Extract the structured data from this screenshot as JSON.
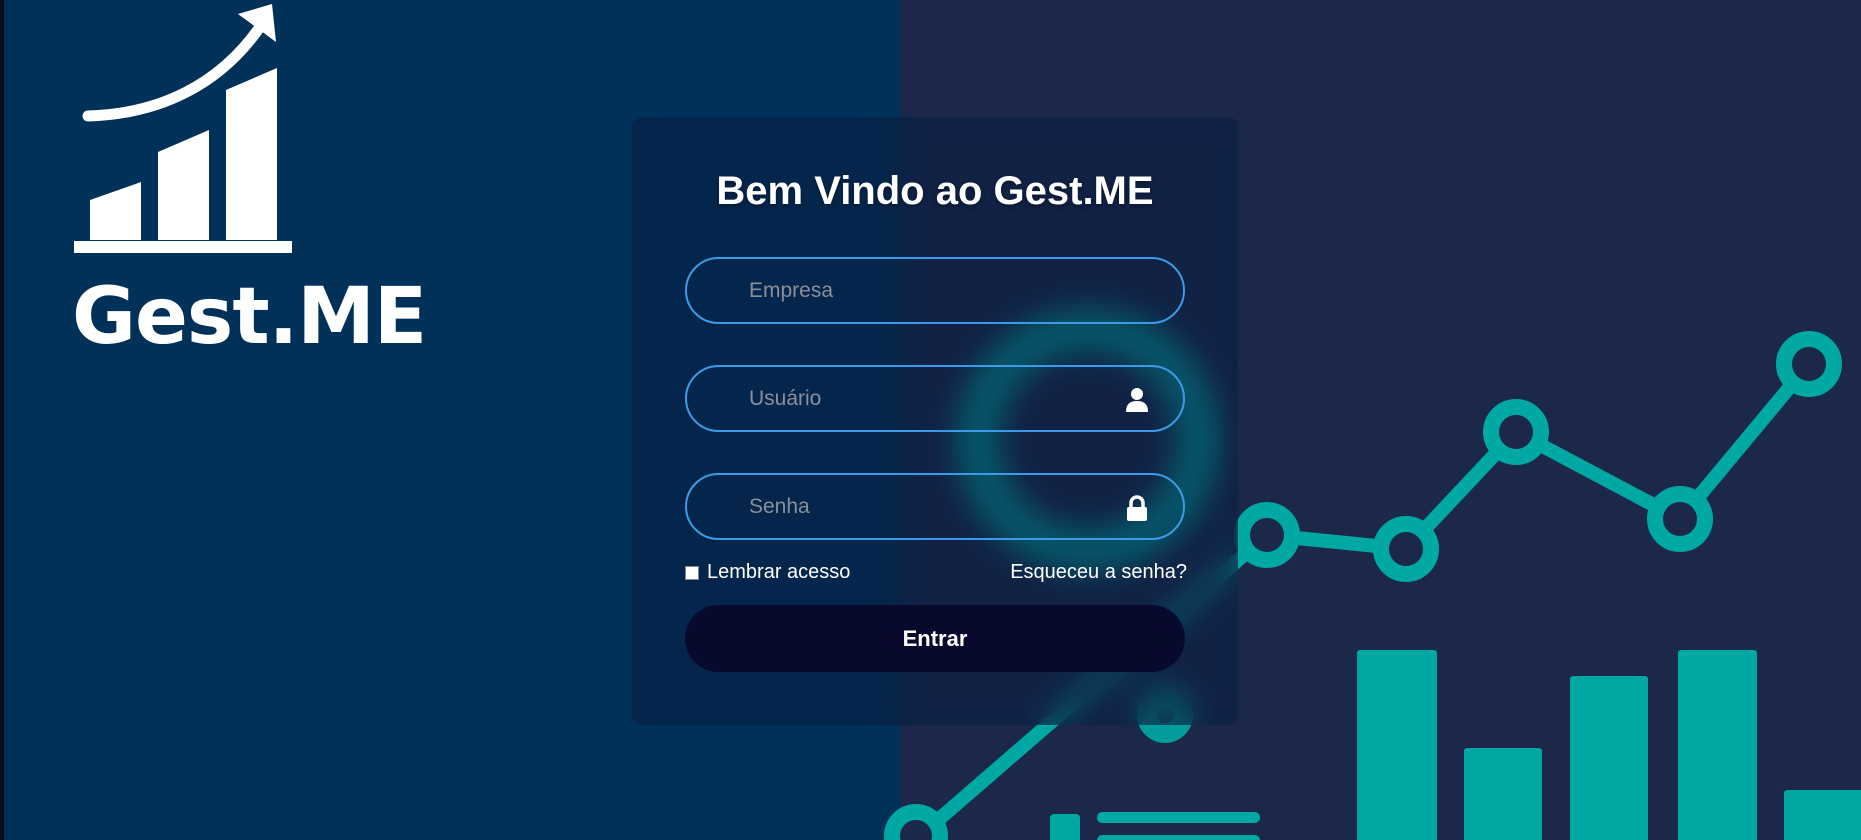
{
  "brand": {
    "name": "Gest.ME"
  },
  "login": {
    "title": "Bem Vindo ao Gest.ME",
    "company_placeholder": "Empresa",
    "user_placeholder": "Usuário",
    "password_placeholder": "Senha",
    "remember_label": "Lembrar acesso",
    "remember_checked": false,
    "forgot_label": "Esqueceu a senha?",
    "submit_label": "Entrar"
  },
  "icons": {
    "user": "user-icon",
    "password": "lock-icon",
    "logo": "growth-chart-icon"
  },
  "colors": {
    "left_background": "#003159",
    "right_background": "#1b2849",
    "accent_teal": "#00a8a3",
    "field_border": "#3b9be8",
    "button_background": "#070a2c",
    "text": "#ffffff"
  }
}
